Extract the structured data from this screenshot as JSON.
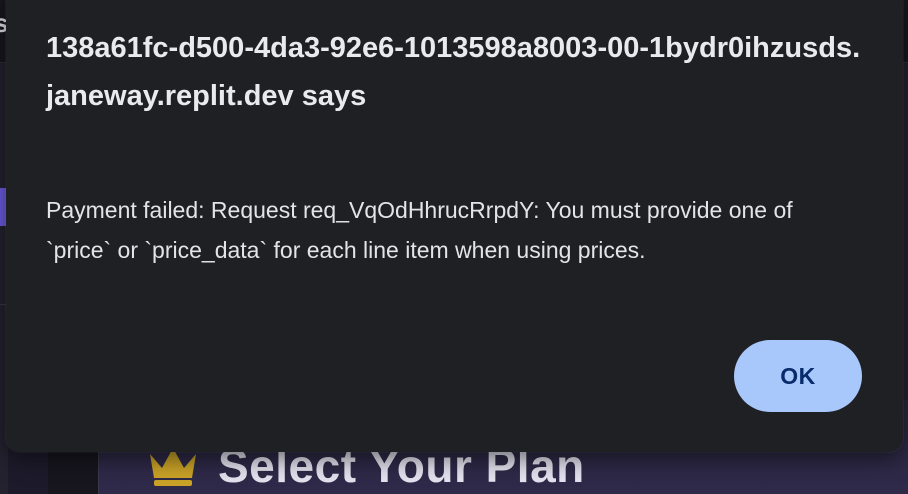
{
  "background": {
    "topbar_glyph": "s",
    "page_heading": "Select Your Plan",
    "heading_icon": "crown-icon",
    "colors": {
      "page_bg": "#1d1b2b",
      "accent": "#6e5ce6",
      "crown": "#c9a227"
    }
  },
  "dialog": {
    "title": "138a61fc-d500-4da3-92e6-1013598a8003-00-1bydr0ihzusds.janeway.replit.dev says",
    "message": "Payment failed: Request req_VqOdHhrucRrpdY: You must provide one of `price` or `price_data` for each line item when using prices.",
    "ok_label": "OK",
    "colors": {
      "dialog_bg": "#1f2023",
      "button_bg": "#a8c7fa",
      "button_text": "#072b6b"
    }
  }
}
